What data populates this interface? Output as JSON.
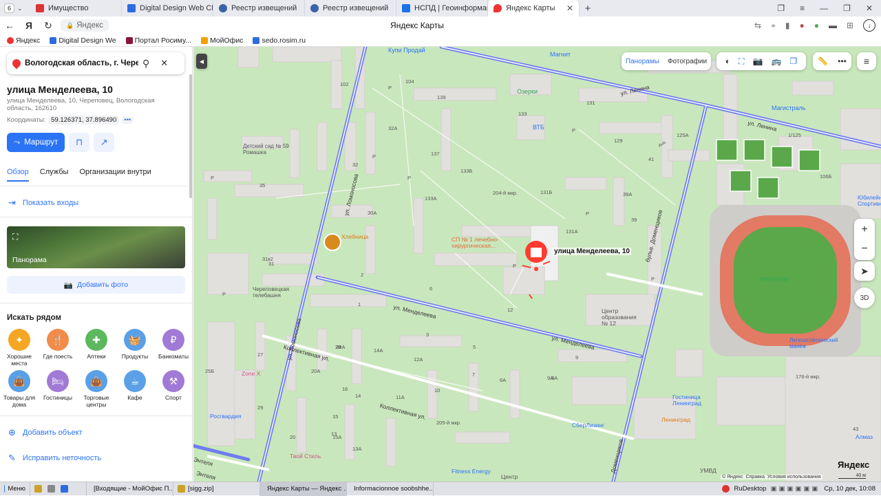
{
  "browser": {
    "tab_counter": "6",
    "tabs": [
      {
        "label": "Имущество",
        "icon": "rts-icon",
        "color": "#d33"
      },
      {
        "label": "Digital Design Web Client",
        "icon": "dd-icon",
        "color": "#2d6cdf"
      },
      {
        "label": "Реестр извещений",
        "icon": "emblem-icon",
        "color": "#3a62a8"
      },
      {
        "label": "Реестр извещений",
        "icon": "emblem-icon",
        "color": "#3a62a8"
      },
      {
        "label": "НСПД | Геоинформацио",
        "icon": "nspd-icon",
        "color": "#1a73e8"
      },
      {
        "label": "Яндекс Карты",
        "icon": "ymaps-icon",
        "color": "#e33",
        "active": true
      }
    ],
    "address_text": "Яндекс",
    "page_title": "Яндекс Карты",
    "bookmarks": [
      {
        "label": "Яндекс",
        "color": "#e33"
      },
      {
        "label": "Digital Design We",
        "color": "#2d6cdf"
      },
      {
        "label": "Портал Росиму...",
        "color": "#8a1538"
      },
      {
        "label": "МойОфис",
        "color": "#f0a000"
      },
      {
        "label": "sedo.rosim.ru",
        "color": "#2d6cdf"
      }
    ]
  },
  "sidebar": {
    "search_value": "Вологодская область, г. Череповец,",
    "place_title": "улица Менделеева, 10",
    "address": "улица Менделеева, 10, Череповец, Вологодская область, 162610",
    "coords_label": "Координаты:",
    "coords_value": "59.126371, 37.896490",
    "route_label": "Маршрут",
    "tabs": [
      "Обзор",
      "Службы",
      "Организации внутри"
    ],
    "show_entrances": "Показать входы",
    "panorama_label": "Панорама",
    "add_photo": "Добавить фото",
    "nearby_title": "Искать рядом",
    "categories": [
      {
        "label": "Хорошие места",
        "color": "#f5a623",
        "icon": "good-places-icon"
      },
      {
        "label": "Где поесть",
        "color": "#f28c4a",
        "icon": "fork-knife-icon"
      },
      {
        "label": "Аптеки",
        "color": "#5cb85c",
        "icon": "pharmacy-icon"
      },
      {
        "label": "Продукты",
        "color": "#5aa0e8",
        "icon": "basket-icon"
      },
      {
        "label": "Банкоматы",
        "color": "#a07ad6",
        "icon": "ruble-icon"
      },
      {
        "label": "Товары для дома",
        "color": "#5aa0e8",
        "icon": "bag-icon"
      },
      {
        "label": "Гостиницы",
        "color": "#a07ad6",
        "icon": "bed-icon"
      },
      {
        "label": "Торговые центры",
        "color": "#5aa0e8",
        "icon": "bag-icon"
      },
      {
        "label": "Кафе",
        "color": "#5aa0e8",
        "icon": "cup-icon"
      },
      {
        "label": "Спорт",
        "color": "#a07ad6",
        "icon": "dumbbell-icon"
      }
    ],
    "add_object": "Добавить объект",
    "fix_error": "Исправить неточность"
  },
  "map": {
    "panoramas": "Панорамы",
    "photos": "Фотографии",
    "selected_label": "улица Менделеева, 10",
    "zoom_in": "+",
    "zoom_out": "−",
    "threed": "3D",
    "brand": "Яндекс",
    "copyright": "© Яндекс  Справка  Условия использования",
    "scale_label": "40 м",
    "streets": [
      {
        "label": "ул. Ломоносова"
      },
      {
        "label": "ул. Ломоносова"
      },
      {
        "label": "ул. Менделеева"
      },
      {
        "label": "ул. Менделеева"
      },
      {
        "label": "ул. Ленина"
      },
      {
        "label": "ул. Ленина"
      },
      {
        "label": "бульв. Доменщиков"
      },
      {
        "label": "Коллективная ул."
      },
      {
        "label": "Коллективная ул."
      },
      {
        "label": "Доменщиков"
      },
      {
        "label": "Энтеля"
      },
      {
        "label": "Энтеля"
      }
    ],
    "pois": [
      {
        "label": "Купи Продай",
        "color": "#2b73f5"
      },
      {
        "label": "Магнит",
        "color": "#2b73f5"
      },
      {
        "label": "Озерки",
        "color": "#2fa84f"
      },
      {
        "label": "ВТБ",
        "color": "#2b73f5"
      },
      {
        "label": "Магистраль",
        "color": "#2b73f5"
      },
      {
        "label": "Детский сад № 59 Ромашка",
        "color": "#555"
      },
      {
        "label": "Хлебница",
        "color": "#e07a10"
      },
      {
        "label": "СП № 1 лечебно-хирургическая...",
        "color": "#e8653c"
      },
      {
        "label": "Череповецкая телебашня",
        "color": "#555"
      },
      {
        "label": "Центр образования № 12",
        "color": "#555"
      },
      {
        "label": "Металлург",
        "color": "#2fa84f"
      },
      {
        "label": "Юбилейный Спортивный",
        "color": "#2b73f5"
      },
      {
        "label": "Легкоатлетический манеж",
        "color": "#2b73f5"
      },
      {
        "label": "Zone X",
        "color": "#d0508a"
      },
      {
        "label": "Росгвардия",
        "color": "#2b73f5"
      },
      {
        "label": "Гостиница Ленинград",
        "color": "#2b73f5"
      },
      {
        "label": "Ленинград",
        "color": "#e07a10"
      },
      {
        "label": "СберЛизинг",
        "color": "#2b73f5"
      },
      {
        "label": "Твой Стиль",
        "color": "#d0508a"
      },
      {
        "label": "Fitness Energy",
        "color": "#2b73f5"
      },
      {
        "label": "Алмаз",
        "color": "#2b73f5"
      },
      {
        "label": "УМВД",
        "color": "#555"
      },
      {
        "label": "Центр",
        "color": "#555"
      }
    ],
    "house_numbers": [
      "104",
      "102",
      "131",
      "133",
      "129",
      "125А",
      "139",
      "137",
      "1/125",
      "106Б",
      "32А",
      "133Б",
      "32",
      "131Б",
      "41",
      "133А",
      "39А",
      "30А",
      "131А",
      "39",
      "31",
      "2",
      "6",
      "12",
      "1",
      "3",
      "5",
      "9",
      "14А",
      "12А",
      "7",
      "8А",
      "9А",
      "20А",
      "14",
      "10",
      "16",
      "6А",
      "28А",
      "28",
      "25Б",
      "15",
      "13",
      "11А",
      "20",
      "27",
      "29",
      "15А",
      "13А",
      "43",
      "35",
      "31к2",
      "176-й мкр.",
      "204-й мкр.",
      "205-й мкр.",
      "Р",
      "Р",
      "Р",
      "Р",
      "Р",
      "Р",
      "Р",
      "Р",
      "Р",
      "Р",
      "Р",
      "Р"
    ]
  },
  "taskbar": {
    "items": [
      {
        "label": "Меню",
        "color": "#3a7bd5"
      },
      {
        "label": "[Входящие - МойОфис П...",
        "color": "#f0a000"
      },
      {
        "label": "[sigg.zip]",
        "color": "#c9a227"
      },
      {
        "label": "Яндекс Карты — Яндекс ...",
        "color": "#2d6cdf"
      },
      {
        "label": "Informacionnoe soobshhe...",
        "color": "#2d6cdf"
      }
    ],
    "tray_label": "RuDesktop",
    "clock": "Ср, 10 дек, 10:08"
  }
}
